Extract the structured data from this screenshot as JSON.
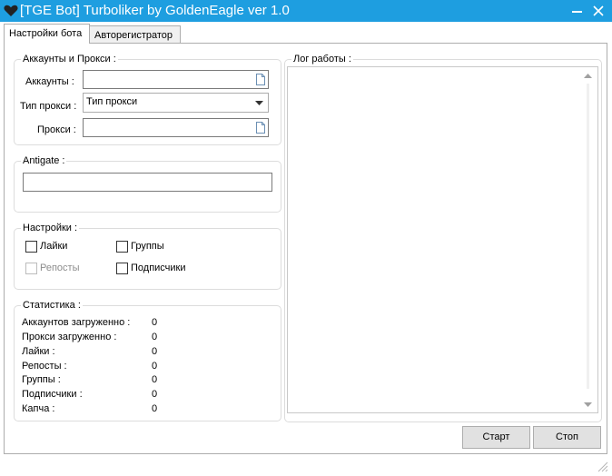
{
  "window": {
    "title": "[TGE Bot] Turboliker by GoldenEagle ver 1.0"
  },
  "tabs": [
    {
      "label": "Настройки бота",
      "active": true
    },
    {
      "label": "Авторегистратор",
      "active": false
    }
  ],
  "accounts_group": {
    "title": "Аккаунты и Прокси :",
    "accounts_label": "Аккаунты :",
    "accounts_value": "",
    "proxy_type_label": "Тип прокси :",
    "proxy_type_value": "Тип прокси",
    "proxy_label": "Прокси :",
    "proxy_value": ""
  },
  "antigate_group": {
    "title": "Antigate :",
    "key_value": ""
  },
  "settings_group": {
    "title": "Настройки :",
    "likes": {
      "label": "Лайки",
      "checked": false
    },
    "groups": {
      "label": "Группы",
      "checked": false
    },
    "reposts": {
      "label": "Репосты",
      "checked": false,
      "disabled": true
    },
    "subscribers": {
      "label": "Подписчики",
      "checked": false
    }
  },
  "stats_group": {
    "title": "Статистика :",
    "rows": [
      {
        "label": "Аккаунтов загруженно :",
        "value": "0"
      },
      {
        "label": "Прокси загруженно :",
        "value": "0"
      },
      {
        "label": "Лайки :",
        "value": "0"
      },
      {
        "label": "Репосты :",
        "value": "0"
      },
      {
        "label": "Группы :",
        "value": "0"
      },
      {
        "label": "Подписчики :",
        "value": "0"
      },
      {
        "label": "Капча :",
        "value": "0"
      }
    ]
  },
  "log_group": {
    "title": "Лог работы :",
    "content": ""
  },
  "buttons": {
    "start": "Старт",
    "stop": "Стоп"
  },
  "colors": {
    "titlebar": "#1e9ee0",
    "border": "#dcdcdc"
  }
}
